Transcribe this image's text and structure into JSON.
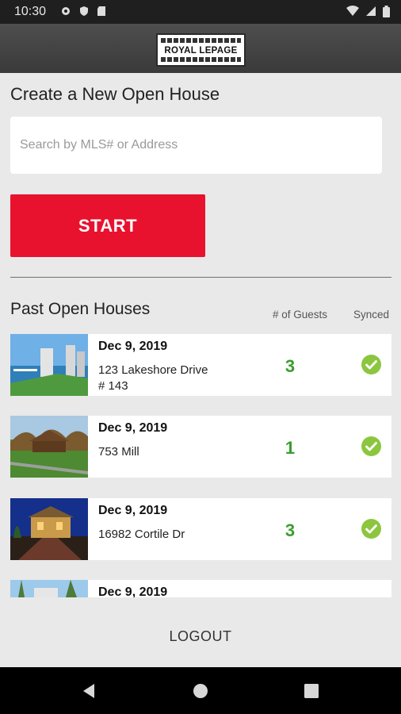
{
  "status_bar": {
    "time": "10:30"
  },
  "brand": {
    "logo_text": "ROYAL LEPAGE"
  },
  "create_section": {
    "title": "Create a New Open House",
    "search_placeholder": "Search by MLS# or Address",
    "start_label": "START"
  },
  "past_section": {
    "title": "Past Open Houses",
    "guests_header": "# of Guests",
    "synced_header": "Synced",
    "items": [
      {
        "date": "Dec 9, 2019",
        "address": "123 Lakeshore Drive # 143",
        "guests": "3",
        "synced": true,
        "thumb": "waterfront-condo"
      },
      {
        "date": "Dec 9, 2019",
        "address": "753 Mill",
        "guests": "1",
        "synced": true,
        "thumb": "country-house"
      },
      {
        "date": "Dec 9, 2019",
        "address": "16982 Cortile Dr",
        "guests": "3",
        "synced": true,
        "thumb": "villa-night"
      },
      {
        "date": "Dec 9, 2019",
        "address": "",
        "guests": "",
        "synced": false,
        "thumb": "palm-trees"
      }
    ]
  },
  "footer": {
    "logout_label": "LOGOUT"
  },
  "colors": {
    "accent_red": "#e8122e",
    "guest_green": "#3a9e2e",
    "synced_green": "#8cc63f"
  }
}
